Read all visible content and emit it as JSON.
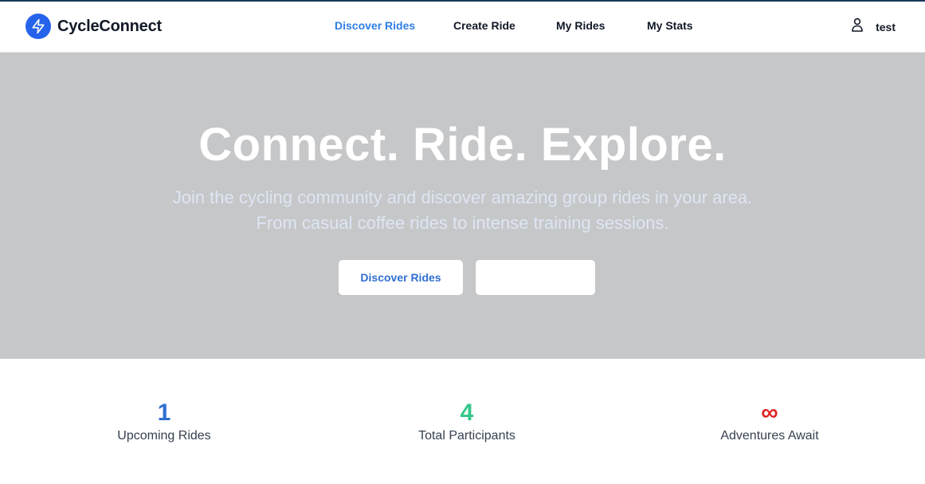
{
  "brand": {
    "name": "CycleConnect",
    "logo_icon": "lightning-bolt-icon",
    "color": "#2563eb"
  },
  "nav": {
    "items": [
      {
        "label": "Discover Rides",
        "active": true
      },
      {
        "label": "Create Ride",
        "active": false
      },
      {
        "label": "My Rides",
        "active": false
      },
      {
        "label": "My Stats",
        "active": false
      }
    ],
    "active_color": "#2f7ee6"
  },
  "user": {
    "icon": "user-icon",
    "name": "test"
  },
  "hero": {
    "title": "Connect. Ride. Explore.",
    "subtitle": "Join the cycling community and discover amazing group rides in your area. From casual coffee rides to intense training sessions.",
    "primary_button": "Discover Rides",
    "secondary_button": "",
    "background": "#c6c7c9"
  },
  "stats": [
    {
      "value": "1",
      "label": "Upcoming Rides",
      "color": "#2f6fd1"
    },
    {
      "value": "4",
      "label": "Total Participants",
      "color": "#34c789"
    },
    {
      "value": "∞",
      "label": "Adventures Await",
      "color": "#dc2626"
    }
  ]
}
